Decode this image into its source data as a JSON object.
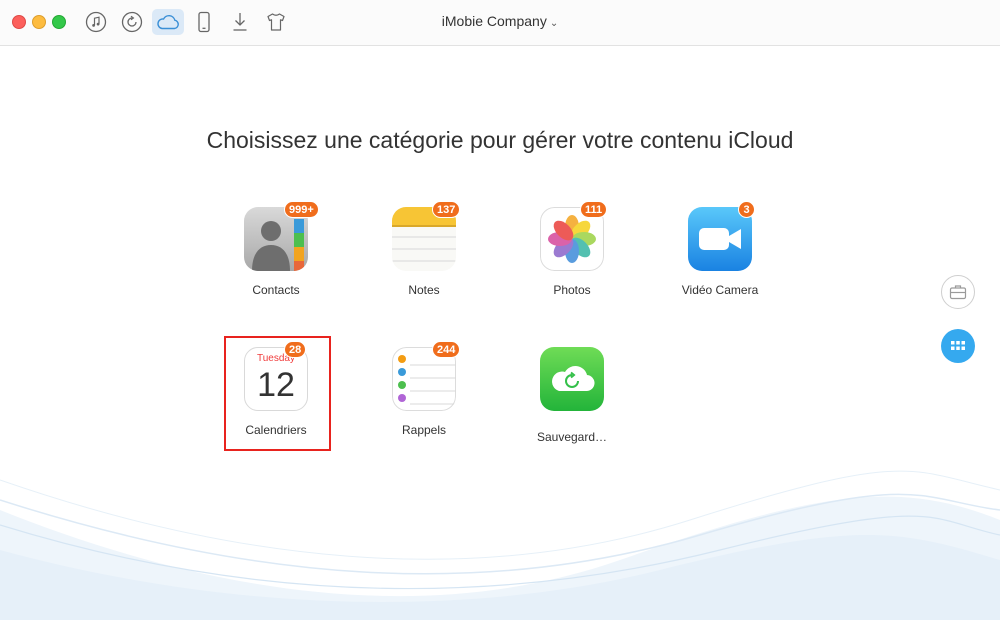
{
  "toolbar": {
    "device_name": "iMobie Company",
    "device_chevron": "⌄",
    "buttons": [
      {
        "name": "music-icon",
        "active": false
      },
      {
        "name": "restore-icon",
        "active": false
      },
      {
        "name": "icloud-icon",
        "active": true
      },
      {
        "name": "device-icon",
        "active": false
      },
      {
        "name": "download-icon",
        "active": false
      },
      {
        "name": "tshirt-icon",
        "active": false
      }
    ]
  },
  "main": {
    "headline": "Choisissez une catégorie pour gérer votre contenu iCloud",
    "categories": [
      {
        "label": "Contacts",
        "badge": "999+",
        "icon": "contacts-icon"
      },
      {
        "label": "Notes",
        "badge": "137",
        "icon": "notes-icon"
      },
      {
        "label": "Photos",
        "badge": "111",
        "icon": "photos-icon"
      },
      {
        "label": "Vidéo Camera",
        "badge": "3",
        "icon": "video-camera-icon"
      },
      {
        "label": "Calendriers",
        "badge": "28",
        "icon": "calendar-icon",
        "calendar_day": "Tuesday",
        "calendar_date": "12",
        "selected": true
      },
      {
        "label": "Rappels",
        "badge": "244",
        "icon": "reminders-icon"
      },
      {
        "label": "Sauvegard…",
        "badge": "",
        "icon": "icloud-backup-icon"
      }
    ]
  },
  "side": {
    "buttons": [
      {
        "name": "toolbox-icon"
      },
      {
        "name": "grid-icon",
        "active": true
      }
    ]
  },
  "colors": {
    "accent": "#35a9ef",
    "badge": "#f06d1c",
    "selection": "#e8231e",
    "toolbar_active": "#dbe9f7"
  }
}
